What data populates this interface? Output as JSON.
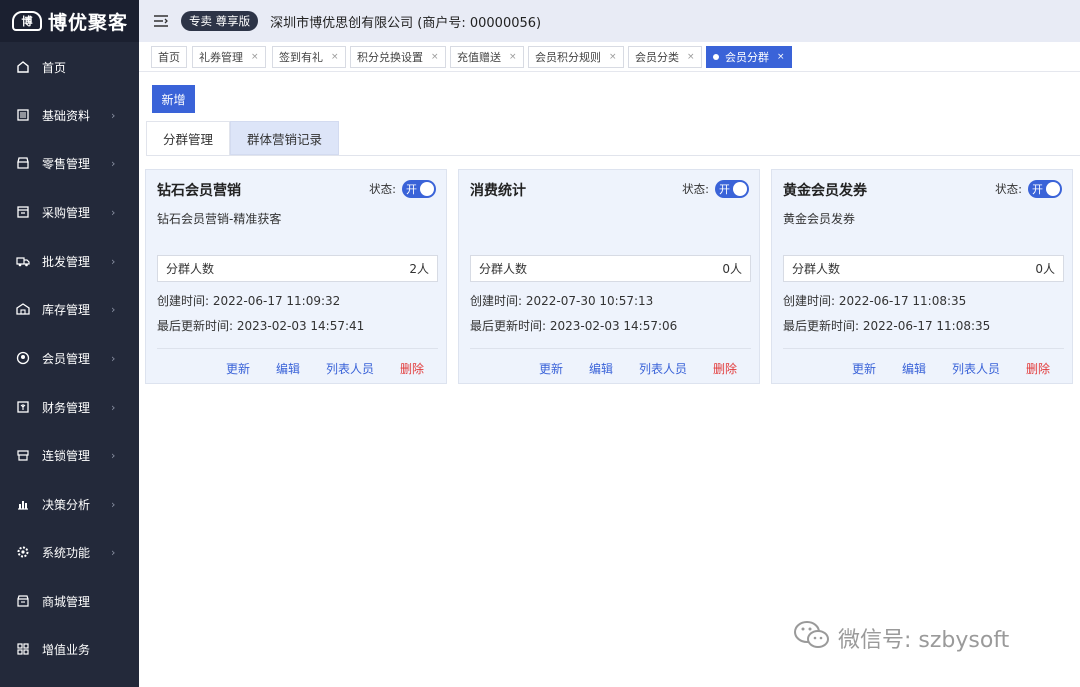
{
  "brand": {
    "logo_mark": "博",
    "name": "博优聚客"
  },
  "header": {
    "edition_badge": "专卖 尊享版",
    "company": "深圳市博优思创有限公司 (商户号: 00000056)"
  },
  "sidebar": {
    "items": [
      {
        "label": "首页",
        "icon": "home-icon"
      },
      {
        "label": "基础资料",
        "icon": "list-icon"
      },
      {
        "label": "零售管理",
        "icon": "store-icon"
      },
      {
        "label": "采购管理",
        "icon": "box-icon"
      },
      {
        "label": "批发管理",
        "icon": "truck-icon"
      },
      {
        "label": "库存管理",
        "icon": "warehouse-icon"
      },
      {
        "label": "会员管理",
        "icon": "member-icon"
      },
      {
        "label": "财务管理",
        "icon": "finance-icon"
      },
      {
        "label": "连锁管理",
        "icon": "chain-icon"
      },
      {
        "label": "决策分析",
        "icon": "chart-icon"
      },
      {
        "label": "系统功能",
        "icon": "gear-icon"
      },
      {
        "label": "商城管理",
        "icon": "mall-icon"
      },
      {
        "label": "增值业务",
        "icon": "grid-icon"
      }
    ]
  },
  "tabs": [
    {
      "label": "首页"
    },
    {
      "label": "礼券管理"
    },
    {
      "label": "签到有礼"
    },
    {
      "label": "积分兑换设置"
    },
    {
      "label": "充值赠送"
    },
    {
      "label": "会员积分规则"
    },
    {
      "label": "会员分类"
    },
    {
      "label": "会员分群"
    }
  ],
  "toolbar": {
    "new_label": "新增"
  },
  "subtabs": [
    {
      "label": "分群管理"
    },
    {
      "label": "群体营销记录"
    }
  ],
  "cards": [
    {
      "title": "钻石会员营销",
      "status_label": "状态:",
      "toggle_label": "开",
      "description": "钻石会员营销-精准获客",
      "count_label": "分群人数",
      "count_value": "2人",
      "created": "创建时间: 2022-06-17 11:09:32",
      "updated": "最后更新时间: 2023-02-03 14:57:41",
      "actions": {
        "refresh": "更新",
        "edit": "编辑",
        "list": "列表人员",
        "delete": "删除"
      }
    },
    {
      "title": "消费统计",
      "status_label": "状态:",
      "toggle_label": "开",
      "description": "",
      "count_label": "分群人数",
      "count_value": "0人",
      "created": "创建时间: 2022-07-30 10:57:13",
      "updated": "最后更新时间: 2023-02-03 14:57:06",
      "actions": {
        "refresh": "更新",
        "edit": "编辑",
        "list": "列表人员",
        "delete": "删除"
      }
    },
    {
      "title": "黄金会员发券",
      "status_label": "状态:",
      "toggle_label": "开",
      "description": "黄金会员发券",
      "count_label": "分群人数",
      "count_value": "0人",
      "created": "创建时间: 2022-06-17 11:08:35",
      "updated": "最后更新时间: 2022-06-17 11:08:35",
      "actions": {
        "refresh": "更新",
        "edit": "编辑",
        "list": "列表人员",
        "delete": "删除"
      }
    }
  ],
  "watermark": {
    "text": "微信号: szbysoft"
  },
  "colors": {
    "sidebar": "#23293a",
    "accent": "#3a63d8",
    "danger": "#e23b3b",
    "header": "#e8ebf5"
  }
}
